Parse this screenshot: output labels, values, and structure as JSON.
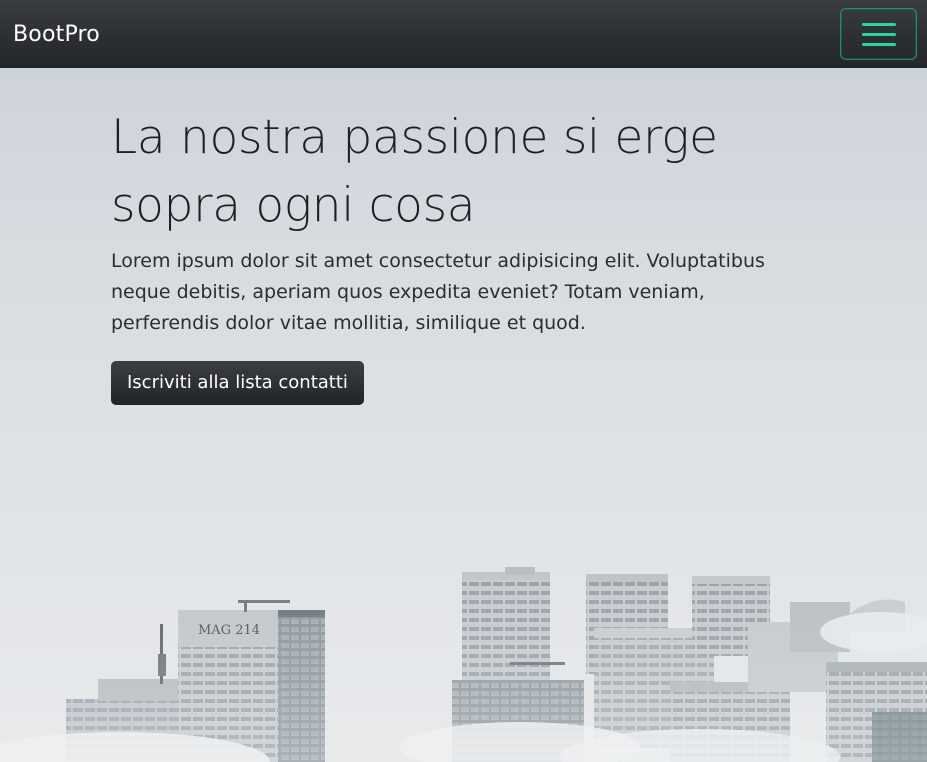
{
  "navbar": {
    "brand": "BootPro",
    "toggler_icon": "hamburger-menu-icon",
    "toggler_color": "#2bd69a"
  },
  "hero": {
    "title_line1": "La nostra passione si erge",
    "title_line2": "sopra ogni cosa",
    "body": "Lorem ipsum dolor sit amet consectetur adipisicing elit. Voluptatibus neque debitis, aperiam quos expedita eveniet? Totam veniam, perferendis dolor vitae mollitia, similique et quod.",
    "cta_label": "Iscriviti alla lista contatti"
  },
  "background": {
    "building_sign": "MAG 214"
  }
}
